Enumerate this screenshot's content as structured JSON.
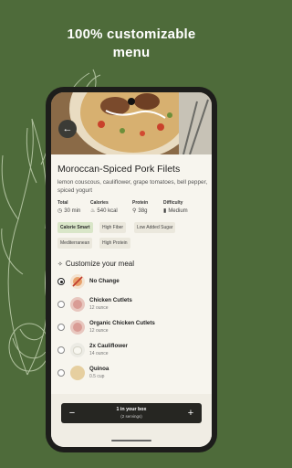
{
  "headline": "100% customizable\nmenu",
  "recipe": {
    "title": "Moroccan-Spiced Pork Filets",
    "ingredients": "lemon couscous, cauliflower, grape tomatoes, bell pepper, spiced yogurt"
  },
  "stats": [
    {
      "label": "Total",
      "value": "30 min",
      "icon": "clock-icon"
    },
    {
      "label": "Calories",
      "value": "540 kcal",
      "icon": "flame-icon"
    },
    {
      "label": "Protein",
      "value": "38g",
      "icon": "protein-icon"
    },
    {
      "label": "Difficulty",
      "value": "Medium",
      "icon": "difficulty-bars-icon"
    }
  ],
  "tags": [
    "Calorie Smart",
    "High Fiber",
    "Low Added Sugar",
    "Mediterranean",
    "High Protein"
  ],
  "customize": {
    "title": "Customize your meal",
    "options": [
      {
        "name": "No Change",
        "qty": "",
        "selected": true
      },
      {
        "name": "Chicken Cutlets",
        "qty": "12 ounce",
        "selected": false
      },
      {
        "name": "Organic Chicken Cutlets",
        "qty": "12 ounce",
        "selected": false
      },
      {
        "name": "2x Cauliflower",
        "qty": "14 ounce",
        "selected": false
      },
      {
        "name": "Quinoa",
        "qty": "0.5 cup",
        "selected": false
      }
    ]
  },
  "box": {
    "label": "1 in your box",
    "servings": "(2 servings)",
    "minus": "−",
    "plus": "+"
  },
  "colors": {
    "background": "#4e6b3a",
    "accent": "#d9e6c8"
  }
}
